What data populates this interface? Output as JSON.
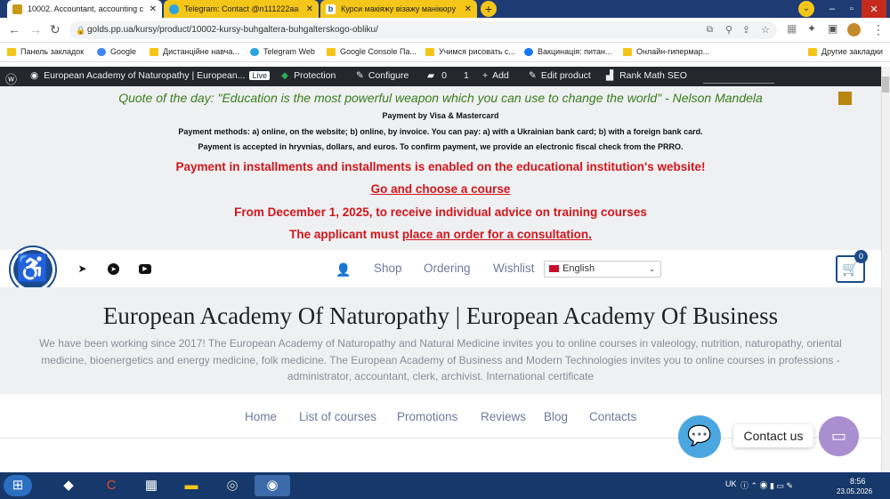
{
  "tabs": [
    {
      "title": "10002. Accountant, accounting c",
      "active": true
    },
    {
      "title": "Telegram: Contact @n111222aa",
      "active": false
    },
    {
      "title": "Курси макіяжу візажу манікюру",
      "active": false
    }
  ],
  "newtab_label": "+",
  "address": {
    "url": "golds.pp.ua/kursy/product/10002-kursy-buhgaltera-buhgalterskogo-obliku/"
  },
  "bookmarks": [
    "Панель закладок",
    "Google",
    "Дистанційне навча...",
    "Telegram Web",
    "Google Console Па...",
    "Учимся рисовать с...",
    "Вакцинація: питан...",
    "Онлайн-гипермар...",
    "Другие закладки"
  ],
  "wpbar": {
    "site": "European Academy of Naturopathy | European...",
    "live": "Live",
    "protection": "Protection",
    "configure": "Configure",
    "comments": "0",
    "updates": "1",
    "add": "Add",
    "edit": "Edit product",
    "seo": "Rank Math SEO"
  },
  "promo": {
    "quote": "Quote of the day: \"Education is the most powerful weapon which you can use to change the world\" - Nelson Mandela",
    "line1": "Payment by Visa & Mastercard",
    "line2": "Payment methods: a) online, on the website; b) online, by invoice. You can pay: a) with a Ukrainian bank card; b) with a foreign bank card.",
    "line3": "Payment is accepted in hryvnias, dollars, and euros. To confirm payment, we provide an electronic fiscal check from the PRRO.",
    "red1": "Payment in installments and installments is enabled on the educational institution's website!",
    "red2": "Go and choose a course",
    "red3": "From December 1, 2025, to receive individual advice on training courses",
    "red4a": "The applicant must ",
    "red4b": "place an order for a consultation."
  },
  "topmenu": {
    "shop": "Shop",
    "ordering": "Ordering",
    "wishlist": "Wishlist",
    "language": "English",
    "cart_count": "0"
  },
  "hero": {
    "title": "European Academy Of Naturopathy | European Academy Of Business",
    "desc": "We have been working since 2017! The European Academy of Naturopathy and Natural Medicine invites you to online courses in valeology, nutrition, naturopathy, oriental medicine, bioenergetics and energy medicine, folk medicine. The European Academy of Business and Modern Technologies invites you to online courses in professions - administrator, accountant, clerk, archivist. International certificate"
  },
  "mainnav": [
    "Home",
    "List of courses",
    "Promotions",
    "Reviews",
    "Blog",
    "Contacts"
  ],
  "contact_label": "Contact us",
  "tray": {
    "lang": "UK",
    "time": "8:56",
    "date": "23.05.2026"
  },
  "colors": {
    "accent": "#1b4b8a",
    "red": "#d1161b",
    "quote": "#3a7d1e"
  }
}
